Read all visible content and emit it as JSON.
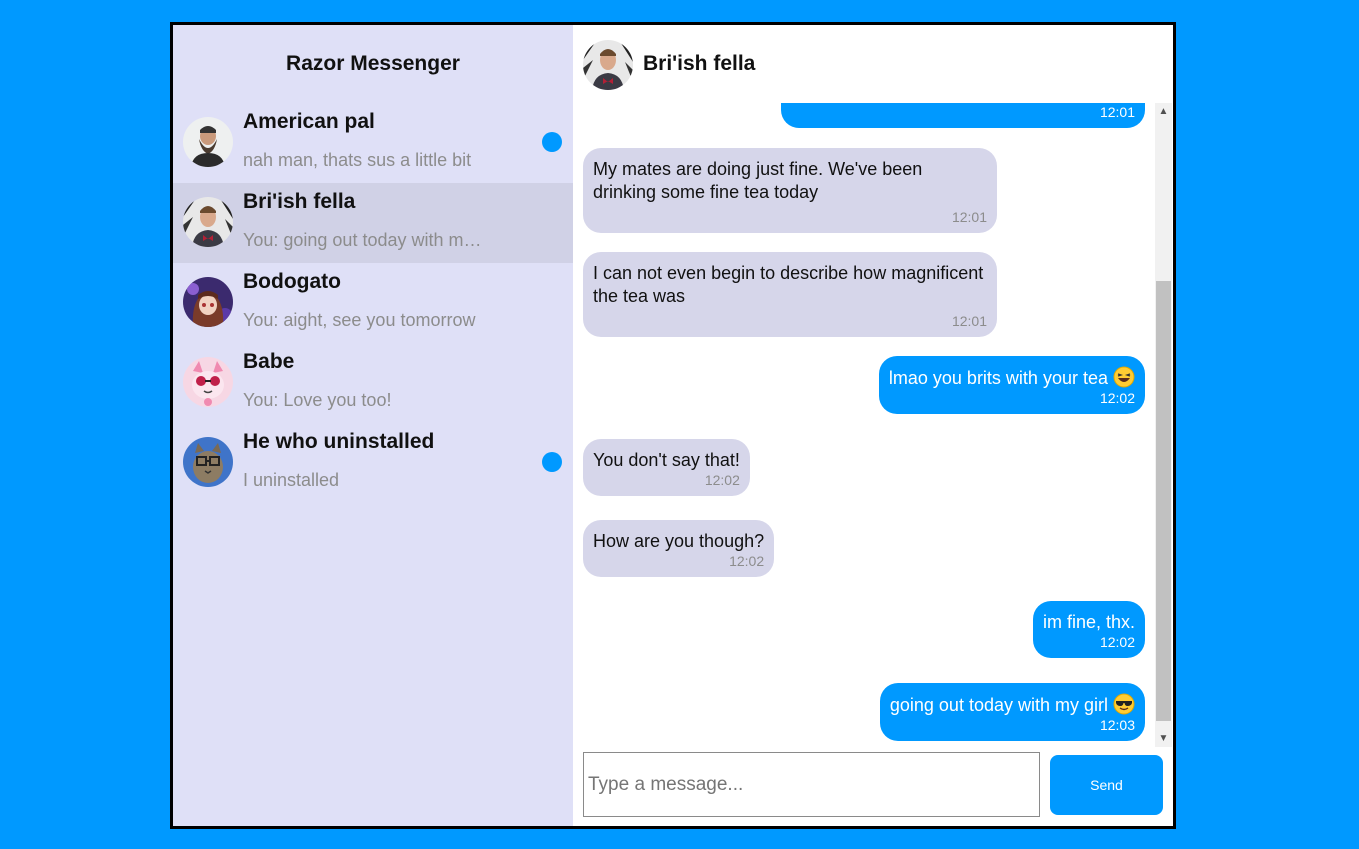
{
  "app": {
    "title": "Razor Messenger"
  },
  "contacts": [
    {
      "name": "American pal",
      "preview": "nah man, thats sus a little bit",
      "unread": true,
      "active": false,
      "avatar": "bearded-man-avatar"
    },
    {
      "name": "Bri'ish fella",
      "preview": "You: going out today with my girl 😎",
      "unread": false,
      "active": true,
      "avatar": "british-man-avatar"
    },
    {
      "name": "Bodogato",
      "preview": "You: aight, see you tomorrow",
      "unread": false,
      "active": false,
      "avatar": "anime-girl-avatar"
    },
    {
      "name": "Babe",
      "preview": "You: Love you too!",
      "unread": false,
      "active": false,
      "avatar": "pink-cat-avatar"
    },
    {
      "name": "He who uninstalled",
      "preview": "I uninstalled",
      "unread": true,
      "active": false,
      "avatar": "cat-glasses-avatar"
    }
  ],
  "chat": {
    "title": "Bri'ish fella",
    "avatar": "british-man-avatar",
    "messages": [
      {
        "dir": "out",
        "text": "",
        "time": "12:01"
      },
      {
        "dir": "in",
        "text": "My mates are doing just fine. We've been drinking some fine tea today",
        "time": "12:01"
      },
      {
        "dir": "in",
        "text": "I can not even begin to describe how magnificent the tea was",
        "time": "12:01"
      },
      {
        "dir": "out",
        "text": "lmao you brits with your tea",
        "emoji": "grinning-squinting-face",
        "time": "12:02"
      },
      {
        "dir": "in",
        "text": "You don't say that!",
        "time": "12:02"
      },
      {
        "dir": "in",
        "text": "How are you though?",
        "time": "12:02"
      },
      {
        "dir": "out",
        "text": "im fine, thx.",
        "time": "12:02"
      },
      {
        "dir": "out",
        "text": "going out today with my girl",
        "emoji": "smiling-face-with-sunglasses",
        "time": "12:03"
      }
    ]
  },
  "composer": {
    "placeholder": "Type a message...",
    "value": "",
    "send_label": "Send"
  },
  "colors": {
    "accent": "#0099ff",
    "sidebar": "#dfe0f7",
    "active_contact": "#d0d1e6",
    "incoming_bubble": "#d6d6ea"
  }
}
